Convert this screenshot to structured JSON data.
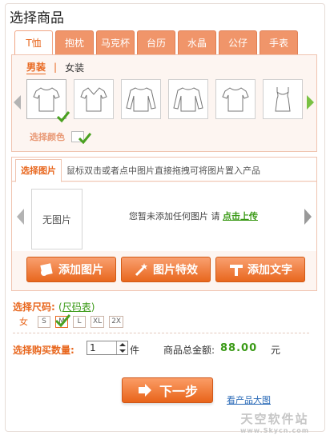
{
  "page": {
    "title": "选择商品"
  },
  "product_tabs": [
    {
      "label": "T恤",
      "active": true
    },
    {
      "label": "抱枕",
      "active": false
    },
    {
      "label": "马克杯",
      "active": false
    },
    {
      "label": "台历",
      "active": false
    },
    {
      "label": "水晶",
      "active": false
    },
    {
      "label": "公仔",
      "active": false
    },
    {
      "label": "手表",
      "active": false
    }
  ],
  "gender": {
    "male": "男装",
    "separator": "|",
    "female": "女装"
  },
  "styles": [
    {
      "icon": "tshirt-icon",
      "selected": true
    },
    {
      "icon": "vneck-tshirt-icon",
      "selected": false
    },
    {
      "icon": "longsleeve-icon",
      "selected": false
    },
    {
      "icon": "longsleeve-icon",
      "selected": false
    },
    {
      "icon": "tshirt-icon",
      "selected": false
    },
    {
      "icon": "tanktop-icon",
      "selected": false
    }
  ],
  "color": {
    "label": "选择颜色"
  },
  "image_section": {
    "tab": "选择图片",
    "hint": "鼠标双击或者点中图片直接拖拽可将图片置入产品",
    "placeholder": "无图片",
    "empty_text": "您暂未添加任何图片 请",
    "upload_link": "点击上传"
  },
  "actions": {
    "add_image": "添加图片",
    "image_effects": "图片特效",
    "add_text": "添加文字"
  },
  "size": {
    "label": "选择尺码:",
    "chart_open": "(",
    "chart_link": "尺码表",
    "chart_close": ")",
    "gender": "女",
    "options": [
      "S",
      "M",
      "L",
      "XL",
      "2X"
    ],
    "selected": "M"
  },
  "quantity": {
    "label": "选择购买数量:",
    "value": "1",
    "unit": "件"
  },
  "total": {
    "label": "商品总金额:",
    "value": "88.00",
    "unit": "元"
  },
  "next_button": "下一步",
  "view_large": "看产品大图",
  "watermark": {
    "line1": "天空软件站",
    "line2": "www.Skycn.com"
  },
  "colors": {
    "accent": "#e8671e",
    "tab": "#f0956a",
    "green": "#3a9a16",
    "panel": "#fdf5f1"
  }
}
